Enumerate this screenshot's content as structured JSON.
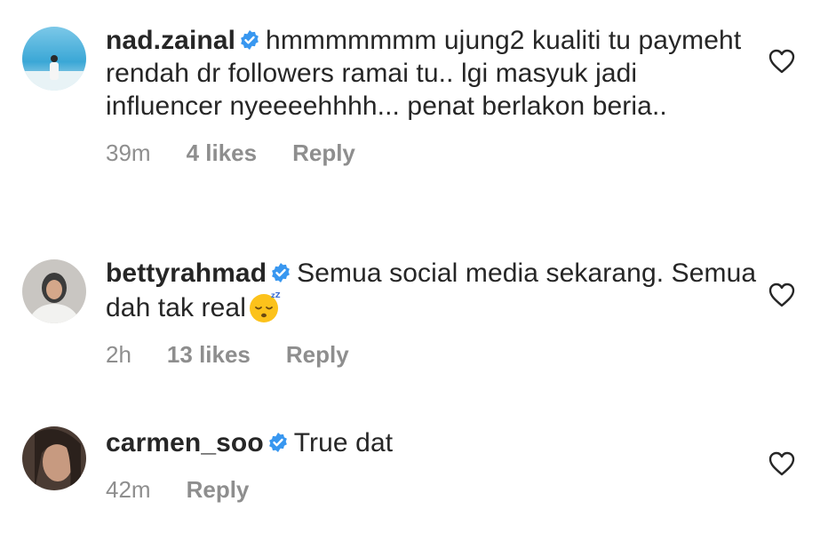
{
  "comments": [
    {
      "username": "nad.zainal",
      "text": "hmmmmmmm ujung2 kualiti tu paymeht rendah dr followers ramai tu.. lgi masyuk jadi influencer nyeeeehhhh... penat berlakon beria..",
      "time": "39m",
      "likes": "4 likes",
      "reply": "Reply",
      "avatar_icon": "avatar-beach-photo"
    },
    {
      "username": "bettyrahmad",
      "text": "Semua social media sekarang. Semua dah tak real",
      "emoji": "sleeping-face-emoji",
      "time": "2h",
      "likes": "13 likes",
      "reply": "Reply",
      "avatar_icon": "avatar-hijab-photo"
    },
    {
      "username": "carmen_soo",
      "text": "True dat",
      "time": "42m",
      "reply": "Reply",
      "avatar_icon": "avatar-portrait-photo"
    }
  ],
  "colors": {
    "text": "#262626",
    "meta": "#8e8e8e",
    "verified": "#3897f0"
  }
}
